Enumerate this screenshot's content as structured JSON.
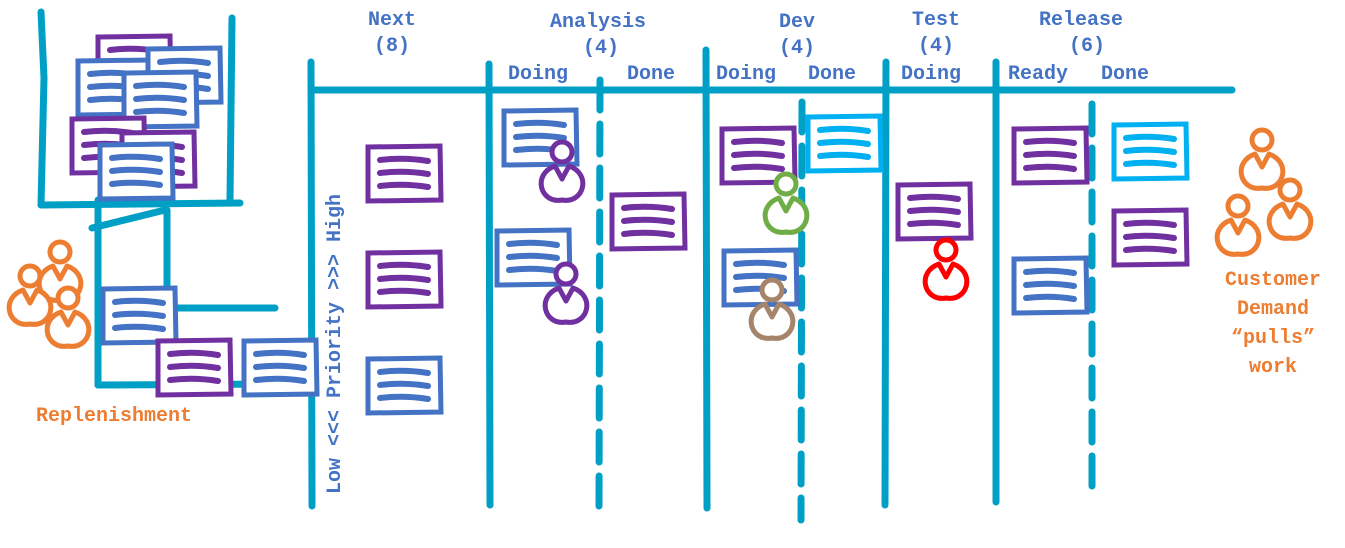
{
  "colors": {
    "board_line": "#00A0C6",
    "header_text": "#4472C4",
    "card_purple": "#7030A0",
    "card_blue": "#4472C4",
    "card_cyan": "#00B0F0",
    "person_orange": "#ED7D31",
    "person_purple": "#7030A0",
    "person_green": "#70AD47",
    "person_brown": "#A5846B",
    "person_red": "#FF0000"
  },
  "columns": {
    "next": {
      "title": "Next",
      "limit": "(8)"
    },
    "analysis": {
      "title": "Analysis",
      "limit": "(4)",
      "sub": [
        "Doing",
        "Done"
      ]
    },
    "dev": {
      "title": "Dev",
      "limit": "(4)",
      "sub": [
        "Doing",
        "Done"
      ]
    },
    "test": {
      "title": "Test",
      "limit": "(4)",
      "sub": [
        "Doing"
      ]
    },
    "release": {
      "title": "Release",
      "limit": "(6)",
      "sub": [
        "Ready",
        "Done"
      ]
    }
  },
  "priority_label": "Low <<< Priority >>> High",
  "replenishment_label": "Replenishment",
  "customer_label": [
    "Customer",
    "Demand",
    "“pulls”",
    "work"
  ],
  "cards": [
    {
      "column": "backlog",
      "color": "purple"
    },
    {
      "column": "backlog",
      "color": "blue"
    },
    {
      "column": "backlog",
      "color": "blue"
    },
    {
      "column": "backlog",
      "color": "blue"
    },
    {
      "column": "backlog",
      "color": "purple"
    },
    {
      "column": "backlog",
      "color": "purple"
    },
    {
      "column": "backlog",
      "color": "blue"
    },
    {
      "column": "replenishment-queue",
      "color": "blue"
    },
    {
      "column": "replenishment-queue",
      "color": "purple"
    },
    {
      "column": "replenishment-queue",
      "color": "blue"
    },
    {
      "column": "next",
      "color": "purple"
    },
    {
      "column": "next",
      "color": "purple"
    },
    {
      "column": "next",
      "color": "blue"
    },
    {
      "column": "analysis-doing",
      "color": "blue"
    },
    {
      "column": "analysis-doing",
      "color": "blue"
    },
    {
      "column": "analysis-done",
      "color": "purple"
    },
    {
      "column": "dev-doing",
      "color": "purple"
    },
    {
      "column": "dev-doing",
      "color": "blue"
    },
    {
      "column": "dev-done",
      "color": "cyan"
    },
    {
      "column": "test-doing",
      "color": "purple"
    },
    {
      "column": "release-ready",
      "color": "purple"
    },
    {
      "column": "release-ready",
      "color": "blue"
    },
    {
      "column": "release-done",
      "color": "cyan"
    },
    {
      "column": "release-done",
      "color": "purple"
    }
  ],
  "people": [
    {
      "group": "replenishment",
      "color": "orange"
    },
    {
      "group": "replenishment",
      "color": "orange"
    },
    {
      "group": "replenishment",
      "color": "orange"
    },
    {
      "group": "analysis-doing",
      "color": "purple"
    },
    {
      "group": "analysis-doing",
      "color": "purple"
    },
    {
      "group": "dev-doing",
      "color": "green"
    },
    {
      "group": "dev-doing",
      "color": "brown"
    },
    {
      "group": "test-doing",
      "color": "red"
    },
    {
      "group": "customer",
      "color": "orange"
    },
    {
      "group": "customer",
      "color": "orange"
    },
    {
      "group": "customer",
      "color": "orange"
    }
  ]
}
